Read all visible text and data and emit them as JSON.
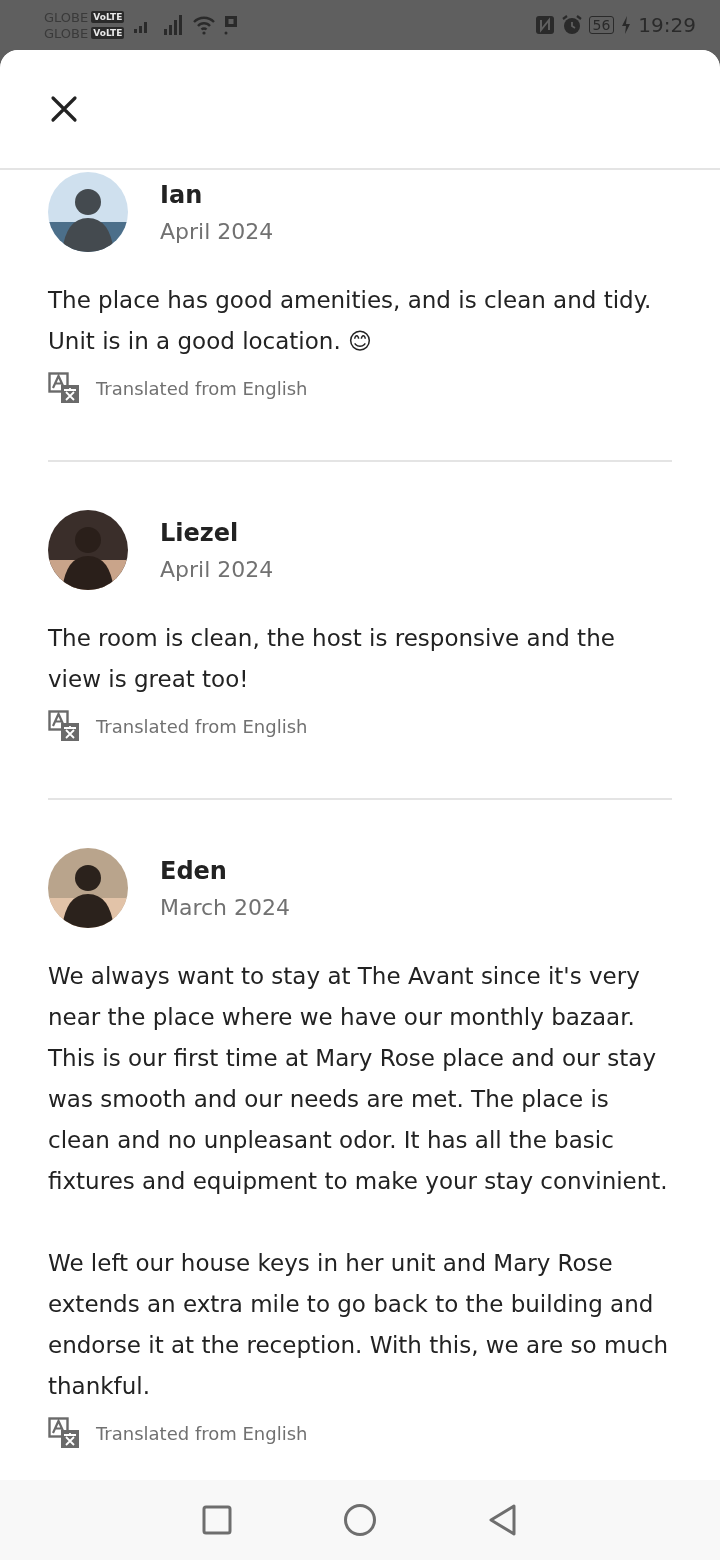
{
  "status_bar": {
    "carriers": [
      {
        "name": "GLOBE",
        "badge": "VoLTE"
      },
      {
        "name": "GLOBE",
        "badge": "VoLTE"
      }
    ],
    "battery": "56",
    "time": "19:29"
  },
  "reviews": [
    {
      "name": "Ian",
      "date": "April 2024",
      "text": "The place has good amenities, and is clean and tidy. Unit is in a good location. 😊",
      "translation_note": "Translated from English"
    },
    {
      "name": "Liezel",
      "date": "April 2024",
      "text": "The room is clean, the host is responsive and the view is great too!",
      "translation_note": "Translated from English"
    },
    {
      "name": "Eden",
      "date": "March 2024",
      "text": "We always want to stay at The Avant since it's very near the place where we have our monthly bazaar. This is our first time at Mary Rose place and our stay was smooth and our needs are met.  The place is clean and no unpleasant odor. It has all the basic fixtures and equipment to make your stay convinient.\n\nWe left our house keys in her unit and Mary Rose extends an extra mile to go back to the building and endorse it at the reception.  With this, we are so much thankful.",
      "translation_note": "Translated from English"
    }
  ]
}
